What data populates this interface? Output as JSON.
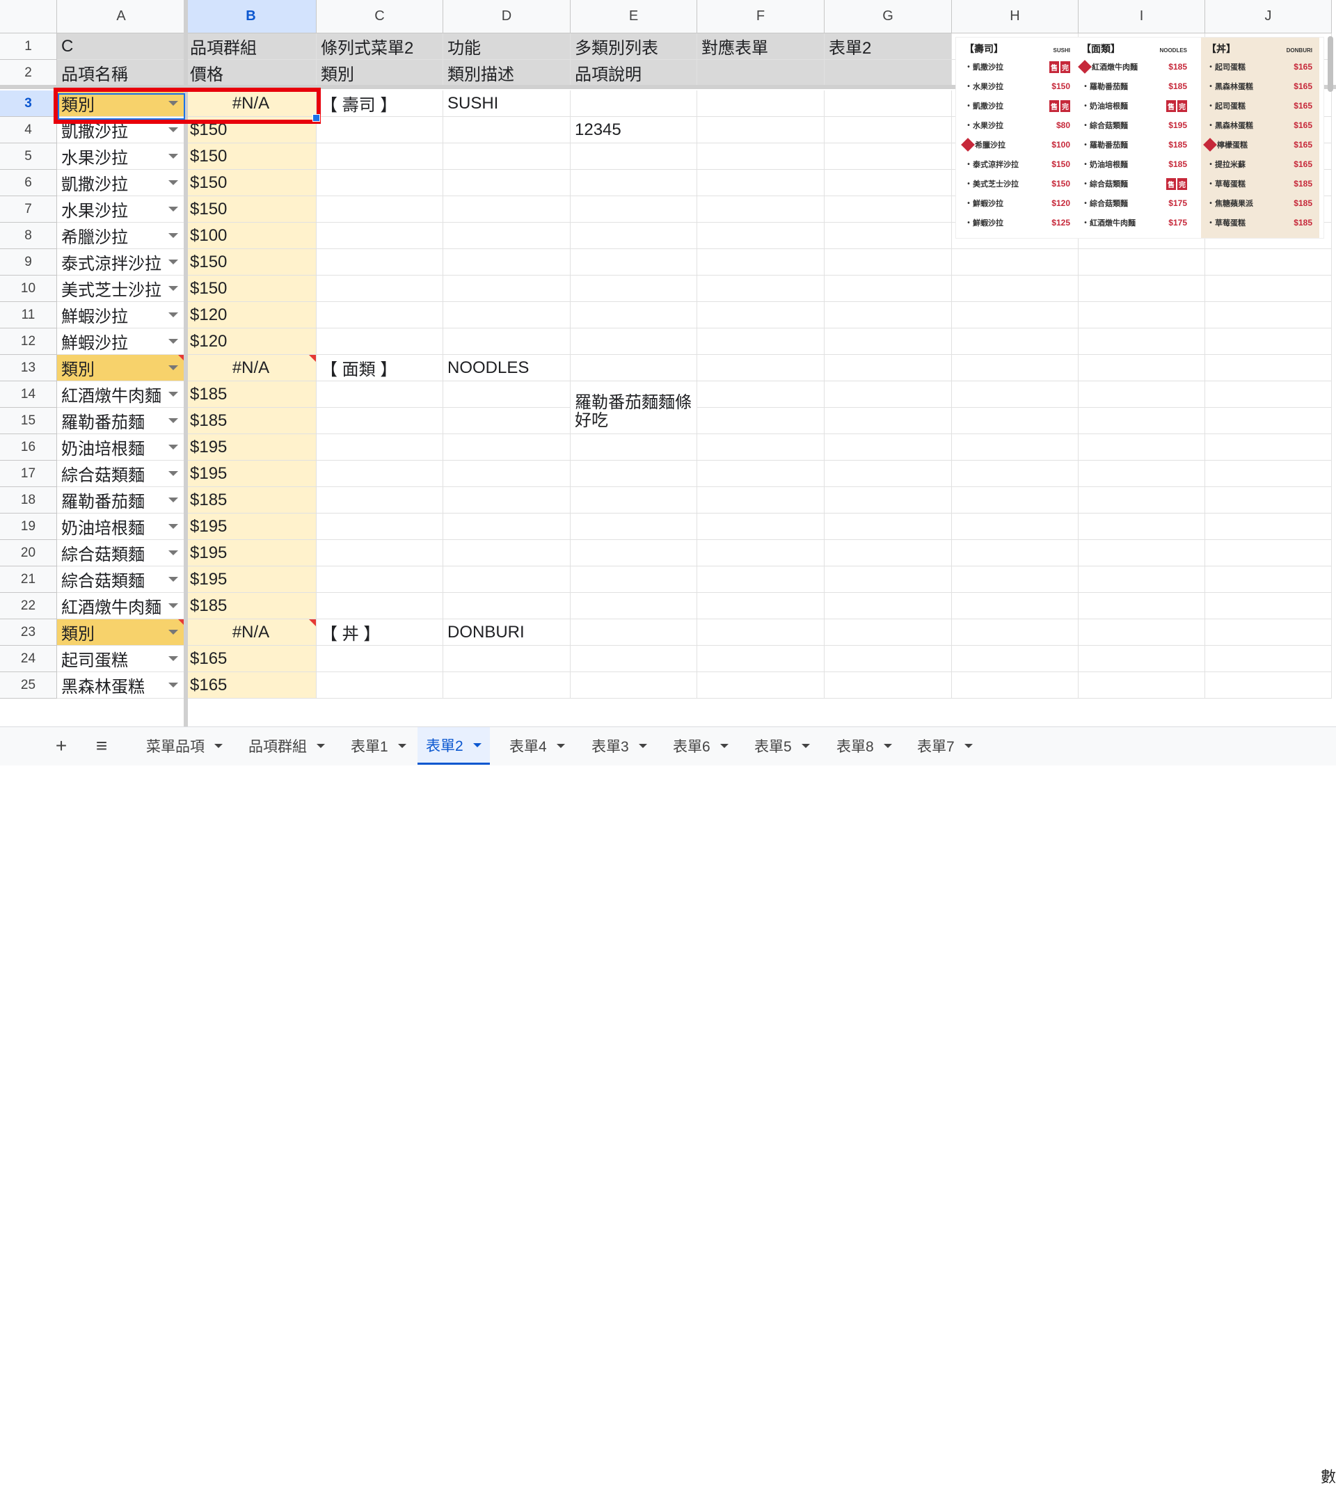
{
  "columns": [
    "A",
    "B",
    "C",
    "D",
    "E",
    "F",
    "G",
    "H",
    "I",
    "J"
  ],
  "active_column": "B",
  "rows": [
    {
      "n": "1",
      "a": "C",
      "b": "品項群組",
      "c": "條列式菜單2",
      "d": "功能",
      "e": "多類別列表",
      "f": "對應表單",
      "g": "表單2"
    },
    {
      "n": "2",
      "a": "品項名稱",
      "b": "價格",
      "c": "類別",
      "d": "類別描述",
      "e": "品項說明",
      "f": "",
      "g": ""
    },
    {
      "n": "3",
      "a": "類別",
      "b": "#N/A",
      "c": "【 壽司 】",
      "d": "SUSHI",
      "e": "",
      "f": "",
      "g": ""
    },
    {
      "n": "4",
      "a": "凱撒沙拉",
      "b": "$150",
      "c": "",
      "d": "",
      "e": "12345",
      "f": "",
      "g": ""
    },
    {
      "n": "5",
      "a": "水果沙拉",
      "b": "$150",
      "c": "",
      "d": "",
      "e": "",
      "f": "",
      "g": ""
    },
    {
      "n": "6",
      "a": "凱撒沙拉",
      "b": "$150",
      "c": "",
      "d": "",
      "e": "",
      "f": "",
      "g": ""
    },
    {
      "n": "7",
      "a": "水果沙拉",
      "b": "$150",
      "c": "",
      "d": "",
      "e": "",
      "f": "",
      "g": ""
    },
    {
      "n": "8",
      "a": "希臘沙拉",
      "b": "$100",
      "c": "",
      "d": "",
      "e": "",
      "f": "",
      "g": ""
    },
    {
      "n": "9",
      "a": "泰式涼拌沙拉",
      "b": "$150",
      "c": "",
      "d": "",
      "e": "",
      "f": "",
      "g": ""
    },
    {
      "n": "10",
      "a": "美式芝士沙拉",
      "b": "$150",
      "c": "",
      "d": "",
      "e": "",
      "f": "",
      "g": ""
    },
    {
      "n": "11",
      "a": "鮮蝦沙拉",
      "b": "$120",
      "c": "",
      "d": "",
      "e": "",
      "f": "",
      "g": ""
    },
    {
      "n": "12",
      "a": "鮮蝦沙拉",
      "b": "$120",
      "c": "",
      "d": "",
      "e": "",
      "f": "",
      "g": ""
    },
    {
      "n": "13",
      "a": "類別",
      "b": "#N/A",
      "c": "【 面類 】",
      "d": "NOODLES",
      "e": "",
      "f": "",
      "g": ""
    },
    {
      "n": "14",
      "a": "紅酒燉牛肉麵",
      "b": "$185",
      "c": "",
      "d": "",
      "e": "",
      "f": "",
      "g": ""
    },
    {
      "n": "15",
      "a": "羅勒番茄麵",
      "b": "$185",
      "c": "",
      "d": "",
      "e": "羅勒番茄麵麵條好吃",
      "f": "",
      "g": ""
    },
    {
      "n": "16",
      "a": "奶油培根麵",
      "b": "$195",
      "c": "",
      "d": "",
      "e": "",
      "f": "",
      "g": ""
    },
    {
      "n": "17",
      "a": "綜合菇類麵",
      "b": "$195",
      "c": "",
      "d": "",
      "e": "",
      "f": "",
      "g": ""
    },
    {
      "n": "18",
      "a": "羅勒番茄麵",
      "b": "$185",
      "c": "",
      "d": "",
      "e": "",
      "f": "",
      "g": ""
    },
    {
      "n": "19",
      "a": "奶油培根麵",
      "b": "$195",
      "c": "",
      "d": "",
      "e": "",
      "f": "",
      "g": ""
    },
    {
      "n": "20",
      "a": "綜合菇類麵",
      "b": "$195",
      "c": "",
      "d": "",
      "e": "",
      "f": "",
      "g": ""
    },
    {
      "n": "21",
      "a": "綜合菇類麵",
      "b": "$195",
      "c": "",
      "d": "",
      "e": "",
      "f": "",
      "g": ""
    },
    {
      "n": "22",
      "a": "紅酒燉牛肉麵",
      "b": "$185",
      "c": "",
      "d": "",
      "e": "",
      "f": "",
      "g": ""
    },
    {
      "n": "23",
      "a": "類別",
      "b": "#N/A",
      "c": "【 丼 】",
      "d": "DONBURI",
      "e": "",
      "f": "",
      "g": ""
    },
    {
      "n": "24",
      "a": "起司蛋糕",
      "b": "$165",
      "c": "",
      "d": "",
      "e": "",
      "f": "",
      "g": ""
    },
    {
      "n": "25",
      "a": "黑森林蛋糕",
      "b": "$165",
      "c": "",
      "d": "",
      "e": "",
      "f": "",
      "g": ""
    }
  ],
  "menu_image": {
    "columns": [
      {
        "title": "【壽司】",
        "en": "SUSHI",
        "items": [
          {
            "name": "凱撒沙拉",
            "price": "",
            "sold": true,
            "rec": false
          },
          {
            "name": "水果沙拉",
            "price": "$150",
            "sold": false,
            "rec": false
          },
          {
            "name": "凱撒沙拉",
            "price": "",
            "sold": true,
            "rec": false
          },
          {
            "name": "水果沙拉",
            "price": "$80",
            "sold": false,
            "rec": false
          },
          {
            "name": "希臘沙拉",
            "price": "$100",
            "sold": false,
            "rec": true
          },
          {
            "name": "泰式涼拌沙拉",
            "price": "$150",
            "sold": false,
            "rec": false
          },
          {
            "name": "美式芝士沙拉",
            "price": "$150",
            "sold": false,
            "rec": false
          },
          {
            "name": "鮮蝦沙拉",
            "price": "$120",
            "sold": false,
            "rec": false
          },
          {
            "name": "鮮蝦沙拉",
            "price": "$125",
            "sold": false,
            "rec": false
          }
        ]
      },
      {
        "title": "【面類】",
        "en": "NOODLES",
        "items": [
          {
            "name": "紅酒燉牛肉麵",
            "price": "$185",
            "sold": false,
            "rec": true
          },
          {
            "name": "羅勒番茄麵",
            "price": "$185",
            "sold": false,
            "rec": false
          },
          {
            "name": "奶油培根麵",
            "price": "",
            "sold": true,
            "rec": false
          },
          {
            "name": "綜合菇類麵",
            "price": "$195",
            "sold": false,
            "rec": false
          },
          {
            "name": "羅勒番茄麵",
            "price": "$185",
            "sold": false,
            "rec": false
          },
          {
            "name": "奶油培根麵",
            "price": "$185",
            "sold": false,
            "rec": false
          },
          {
            "name": "綜合菇類麵",
            "price": "",
            "sold": true,
            "rec": false
          },
          {
            "name": "綜合菇類麵",
            "price": "$175",
            "sold": false,
            "rec": false
          },
          {
            "name": "紅酒燉牛肉麵",
            "price": "$175",
            "sold": false,
            "rec": false
          }
        ]
      },
      {
        "title": "【丼】",
        "en": "DONBURI",
        "items": [
          {
            "name": "起司蛋糕",
            "price": "$165",
            "sold": false,
            "rec": false
          },
          {
            "name": "黑森林蛋糕",
            "price": "$165",
            "sold": false,
            "rec": false
          },
          {
            "name": "起司蛋糕",
            "price": "$165",
            "sold": false,
            "rec": false
          },
          {
            "name": "黑森林蛋糕",
            "price": "$165",
            "sold": false,
            "rec": false
          },
          {
            "name": "檸檬蛋糕",
            "price": "$165",
            "sold": false,
            "rec": true
          },
          {
            "name": "提拉米蘇",
            "price": "$165",
            "sold": false,
            "rec": false
          },
          {
            "name": "草莓蛋糕",
            "price": "$185",
            "sold": false,
            "rec": false
          },
          {
            "name": "焦糖蘋果派",
            "price": "$185",
            "sold": false,
            "rec": false
          },
          {
            "name": "草莓蛋糕",
            "price": "$185",
            "sold": false,
            "rec": false
          }
        ]
      }
    ],
    "sold_chars": [
      "售",
      "完"
    ],
    "rec_text": "推薦"
  },
  "tabs": [
    {
      "label": "菜單品項",
      "active": false
    },
    {
      "label": "品項群組",
      "active": false
    },
    {
      "label": "表單1",
      "active": false
    },
    {
      "label": "表單2",
      "active": true
    },
    {
      "label": "表單4",
      "active": false
    },
    {
      "label": "表單3",
      "active": false
    },
    {
      "label": "表單6",
      "active": false
    },
    {
      "label": "表單5",
      "active": false
    },
    {
      "label": "表單8",
      "active": false
    },
    {
      "label": "表單7",
      "active": false
    }
  ],
  "tab_bar": {
    "add_icon": "+",
    "menu_icon": "≡"
  },
  "edge_glyph": "數",
  "colors": {
    "accent": "#0b57d0",
    "selection": "#e8000b",
    "header_bg": "#d9d9d9",
    "yellow": "#fff2cc",
    "category": "#f7d26b",
    "price_red": "#c6283a"
  }
}
